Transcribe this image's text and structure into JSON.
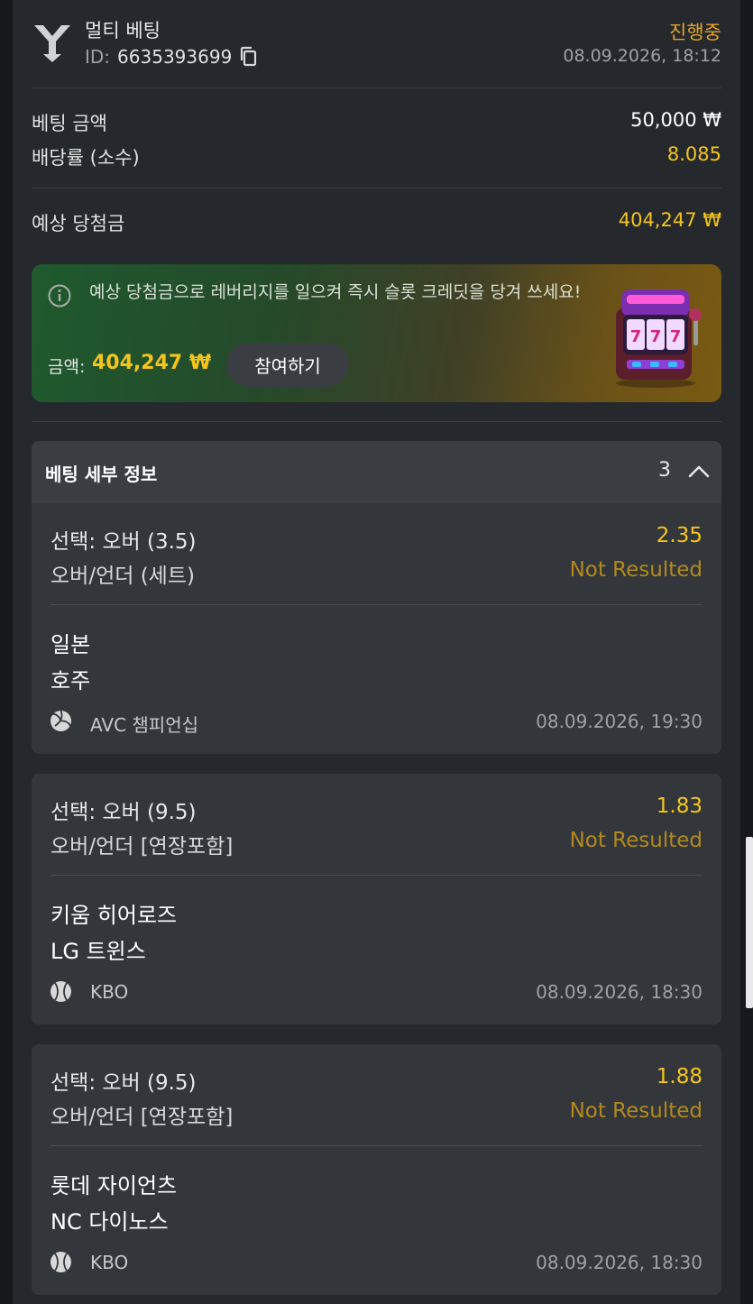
{
  "header": {
    "title": "멀티 베팅",
    "id_label": "ID:",
    "id_value": "6635393699",
    "status": "진행중",
    "datetime": "08.09.2026, 18:12"
  },
  "summary": {
    "stake_label": "베팅 금액",
    "stake_value": "50,000 ₩",
    "odds_label": "배당률 (소수)",
    "odds_value": "8.085",
    "payout_label": "예상 당첨금",
    "payout_value": "404,247 ₩"
  },
  "promo": {
    "text": "예상 당첨금으로 레버리지를 일으켜 즉시 슬롯 크레딧을 당겨 쓰세요!",
    "amount_label": "금액:",
    "amount_value": "404,247 ₩",
    "button_label": "참여하기"
  },
  "details": {
    "title": "베팅 세부 정보",
    "count": "3"
  },
  "selections": [
    {
      "selection": "선택: 오버 (3.5)",
      "odds": "2.35",
      "market": "오버/언더 (세트)",
      "result": "Not Resulted",
      "team1": "일본",
      "team2": "호주",
      "sport_icon": "volleyball-icon",
      "league": "AVC 챔피언십",
      "datetime": "08.09.2026, 19:30"
    },
    {
      "selection": "선택: 오버 (9.5)",
      "odds": "1.83",
      "market": "오버/언더 [연장포함]",
      "result": "Not Resulted",
      "team1": "키움 히어로즈",
      "team2": "LG 트윈스",
      "sport_icon": "baseball-icon",
      "league": "KBO",
      "datetime": "08.09.2026, 18:30"
    },
    {
      "selection": "선택: 오버 (9.5)",
      "odds": "1.88",
      "market": "오버/언더 [연장포함]",
      "result": "Not Resulted",
      "team1": "롯데 자이언츠",
      "team2": "NC 다이노스",
      "sport_icon": "baseball-icon",
      "league": "KBO",
      "datetime": "08.09.2026, 18:30"
    }
  ],
  "icons": {
    "header": "multi-bet-icon",
    "copy": "copy-icon",
    "info": "info-icon",
    "chevron": "chevron-up-icon",
    "promo_image": "slot-machine-icon"
  },
  "colors": {
    "accent_yellow": "#f5c51b",
    "status_orange": "#e5a52b",
    "result_gold": "#b28a1c",
    "background": "#25282c"
  }
}
